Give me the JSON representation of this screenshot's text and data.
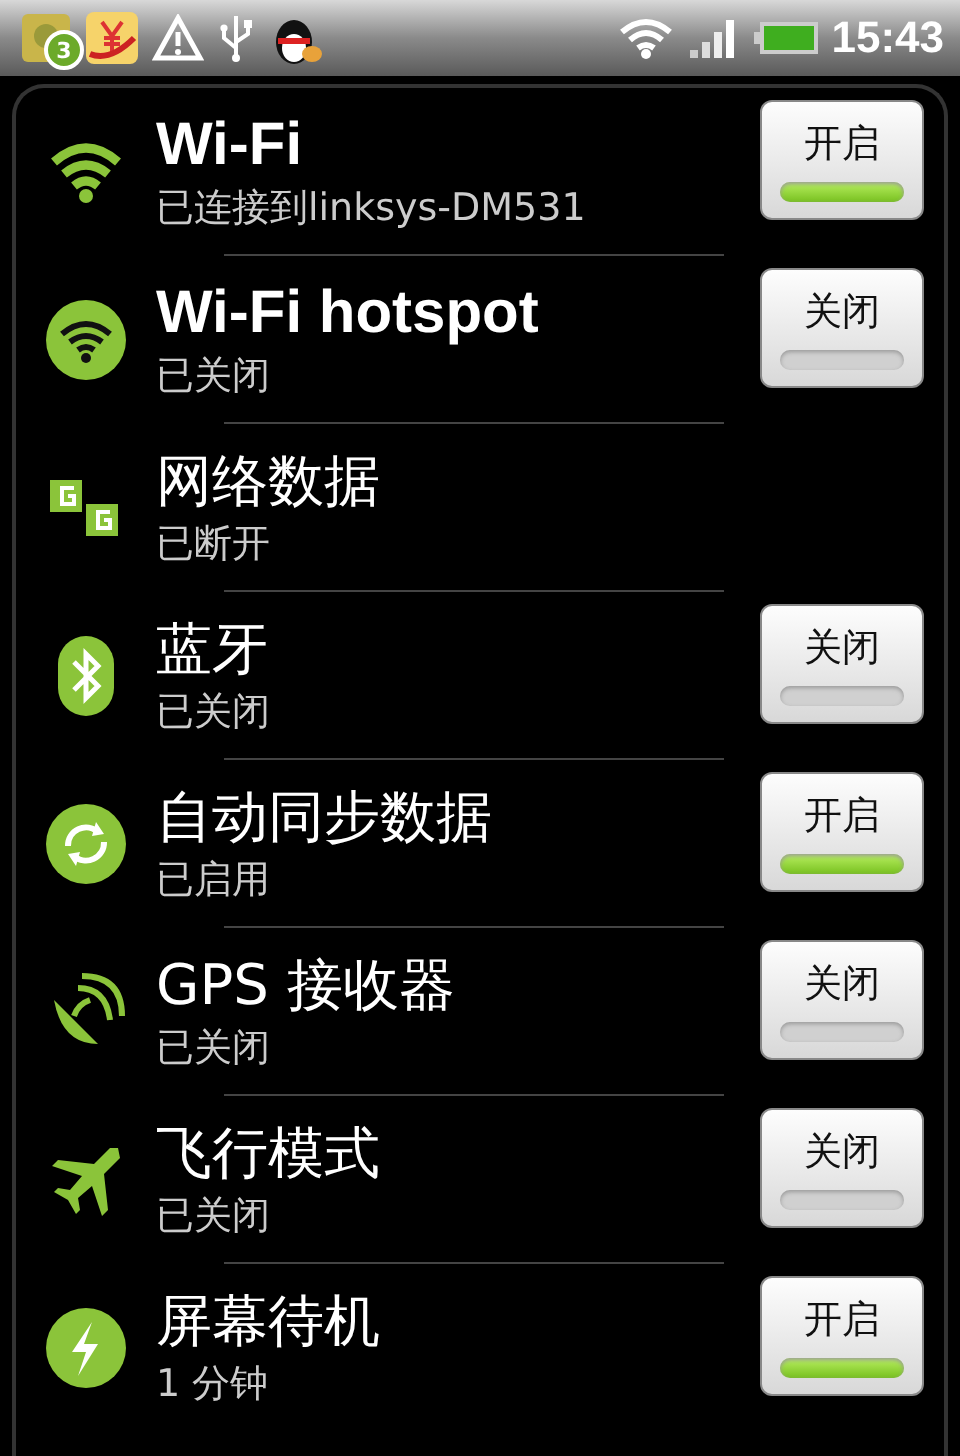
{
  "status_bar": {
    "badge": "3",
    "time": "15:43"
  },
  "items": [
    {
      "title": "Wi-Fi",
      "subtitle": "已连接到linksys-DM531",
      "toggle": {
        "label": "开启",
        "on": true
      }
    },
    {
      "title": "Wi-Fi hotspot",
      "subtitle": "已关闭",
      "toggle": {
        "label": "关闭",
        "on": false
      }
    },
    {
      "title": "网络数据",
      "subtitle": "已断开"
    },
    {
      "title": "蓝牙",
      "subtitle": "已关闭",
      "toggle": {
        "label": "关闭",
        "on": false
      }
    },
    {
      "title": "自动同步数据",
      "subtitle": "已启用",
      "toggle": {
        "label": "开启",
        "on": true
      }
    },
    {
      "title": "GPS 接收器",
      "subtitle": "已关闭",
      "toggle": {
        "label": "关闭",
        "on": false
      }
    },
    {
      "title": "飞行模式",
      "subtitle": "已关闭",
      "toggle": {
        "label": "关闭",
        "on": false
      }
    },
    {
      "title": "屏幕待机",
      "subtitle": "1 分钟",
      "toggle": {
        "label": "开启",
        "on": true
      }
    }
  ]
}
